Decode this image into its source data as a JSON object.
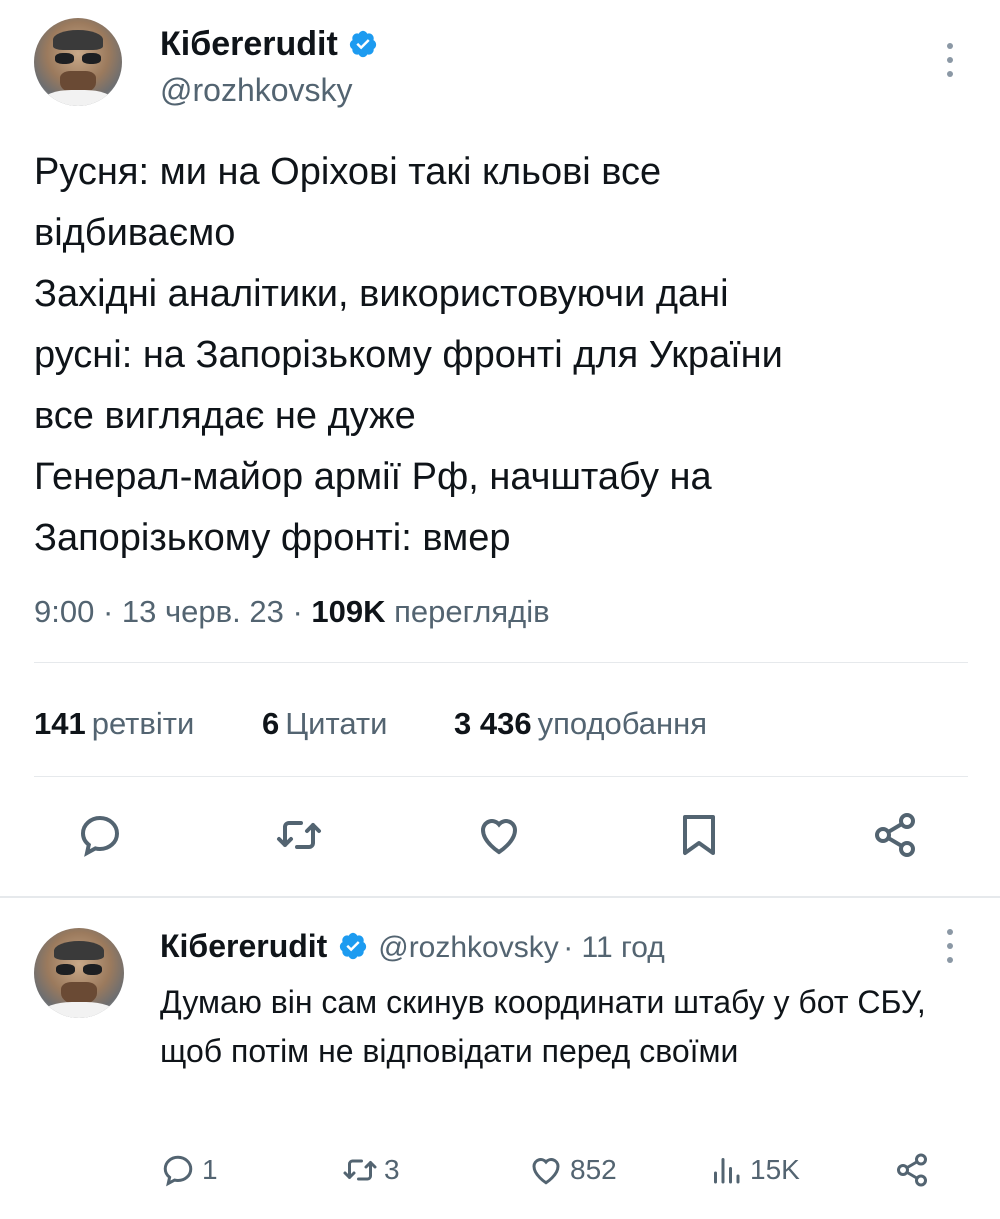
{
  "main_tweet": {
    "author_name": "Кібererudit",
    "author_handle": "@rozhkovsky",
    "text": "Русня: ми на Оріхові такі кльові все\nвідбиваємо\nЗахідні аналітики, використовуючи дані\nрусні: на Запорізькому фронті для України\nвсе виглядає не дуже\nГенерал-майор армії Рф, начштабу на\nЗапорізькому фронті: вмер",
    "time": "9:00",
    "date": "13 черв. 23",
    "views_count": "109K",
    "views_label": "переглядів",
    "retweets_count": "141",
    "retweets_label": "ретвіти",
    "quotes_count": "6",
    "quotes_label": "Цитати",
    "likes_count": "3 436",
    "likes_label": "уподобання"
  },
  "reply": {
    "author_name": "Кібererudit",
    "author_handle": "@rozhkovsky",
    "age": "11 год",
    "text": "Думаю він сам скинув координати штабу у бот СБУ, щоб потім не відповідати перед своїми",
    "replies": "1",
    "retweets": "3",
    "likes": "852",
    "views": "15K"
  },
  "icons": [
    "verified-badge-icon",
    "more-options-icon",
    "reply-icon",
    "retweet-icon",
    "like-icon",
    "bookmark-icon",
    "share-icon",
    "views-icon"
  ],
  "colors": {
    "verified": "#1d9bf0",
    "text": "#0f1419",
    "secondary": "#536471",
    "divider": "#e6e9ec"
  }
}
